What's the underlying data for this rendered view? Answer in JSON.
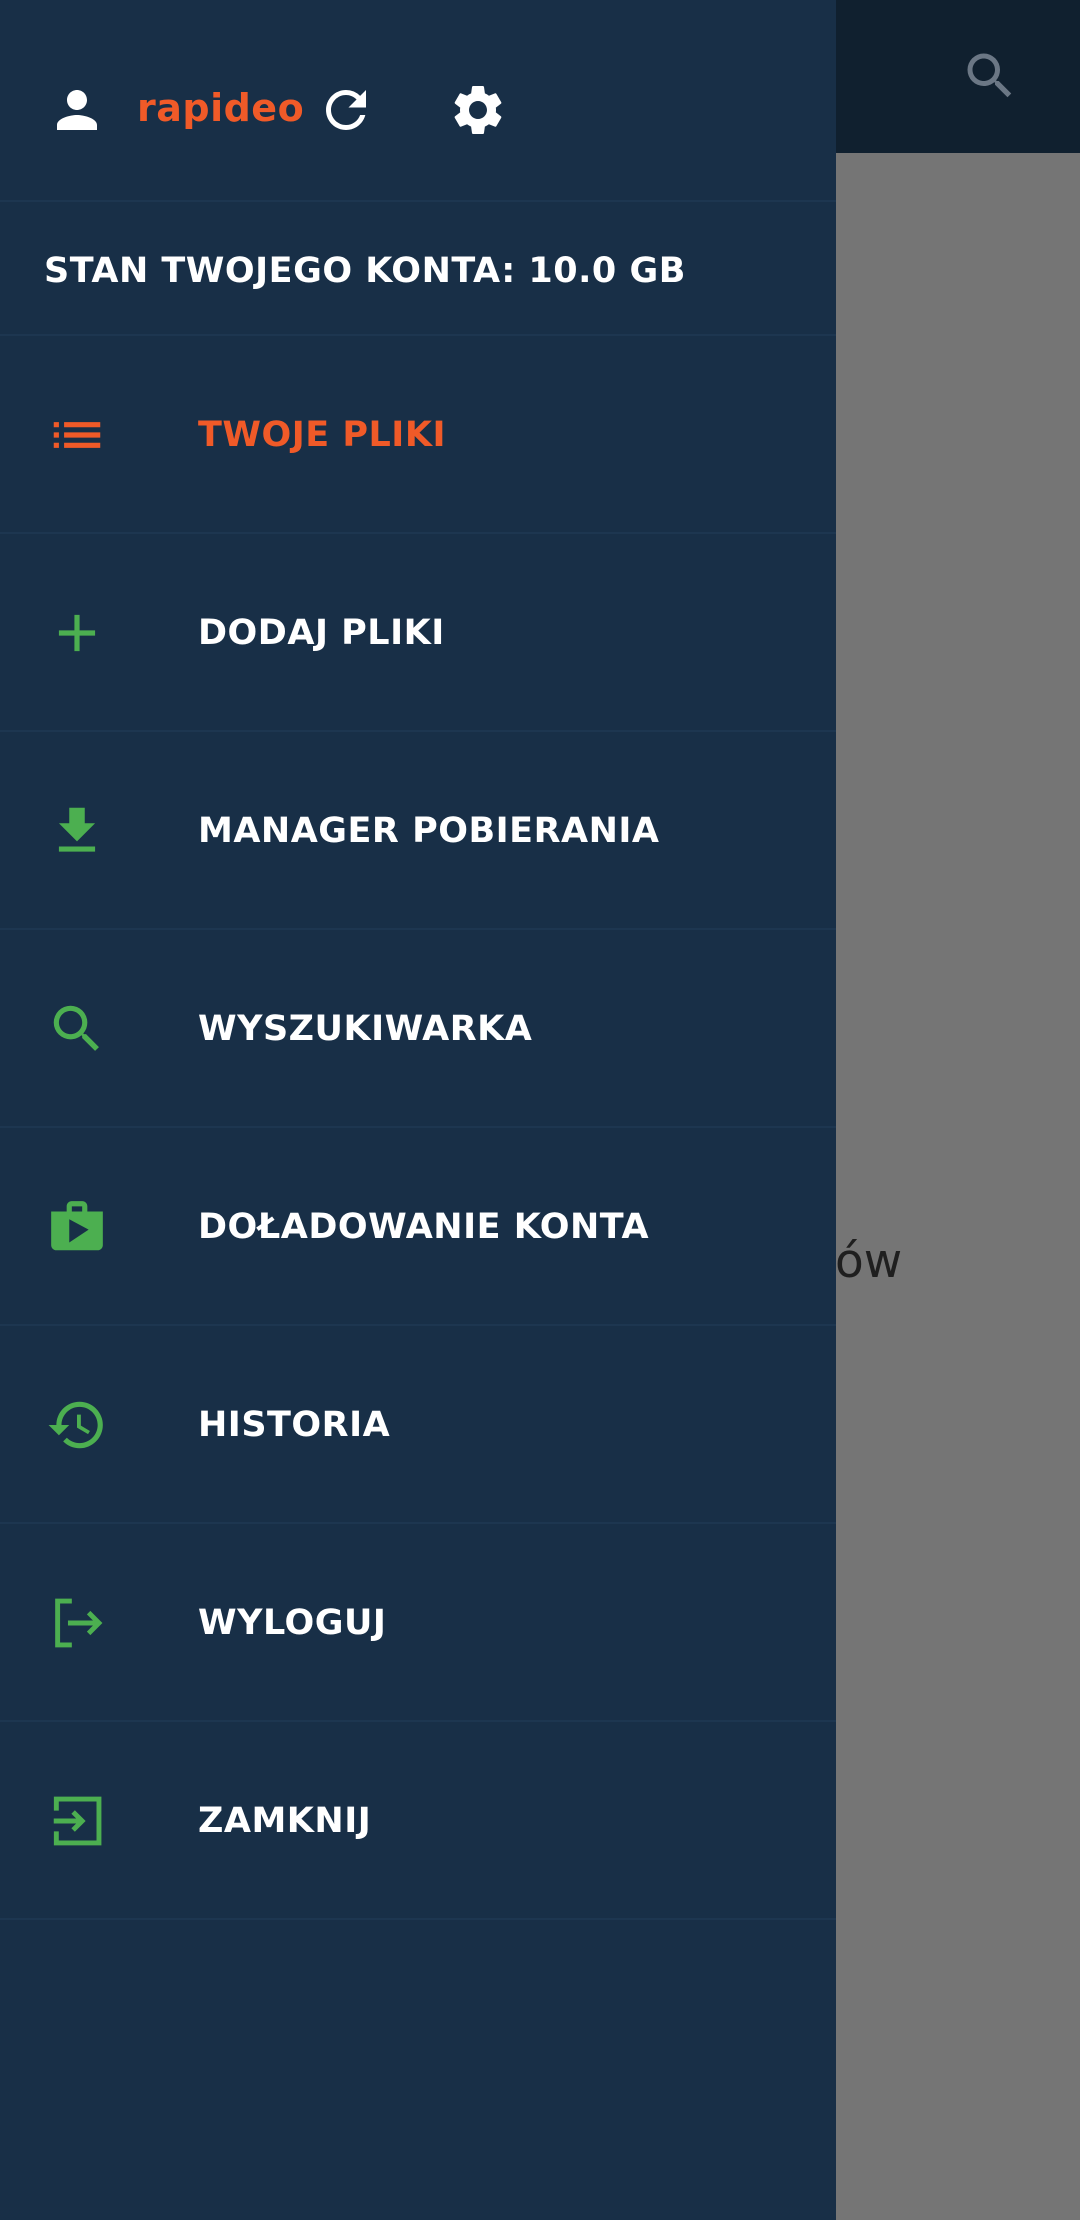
{
  "background": {
    "empty_text": "ów"
  },
  "drawer": {
    "brand": "rapideo",
    "balance": "STAN TWOJEGO KONTA: 10.0 GB",
    "items": [
      {
        "label": "TWOJE PLIKI",
        "icon": "list-icon",
        "active": true
      },
      {
        "label": "DODAJ PLIKI",
        "icon": "plus-icon",
        "active": false
      },
      {
        "label": "MANAGER POBIERANIA",
        "icon": "download-icon",
        "active": false
      },
      {
        "label": "WYSZUKIWARKA",
        "icon": "search-icon",
        "active": false
      },
      {
        "label": "DOŁADOWANIE KONTA",
        "icon": "shop-bag-icon",
        "active": false
      },
      {
        "label": "HISTORIA",
        "icon": "history-icon",
        "active": false
      },
      {
        "label": "WYLOGUJ",
        "icon": "logout-icon",
        "active": false
      },
      {
        "label": "ZAMKNIJ",
        "icon": "close-app-icon",
        "active": false
      }
    ]
  },
  "colors": {
    "drawer_bg": "#182f47",
    "accent_orange": "#f05a28",
    "icon_green": "#4caf50",
    "app_bar": "#10202f",
    "scrim": "#757575"
  }
}
